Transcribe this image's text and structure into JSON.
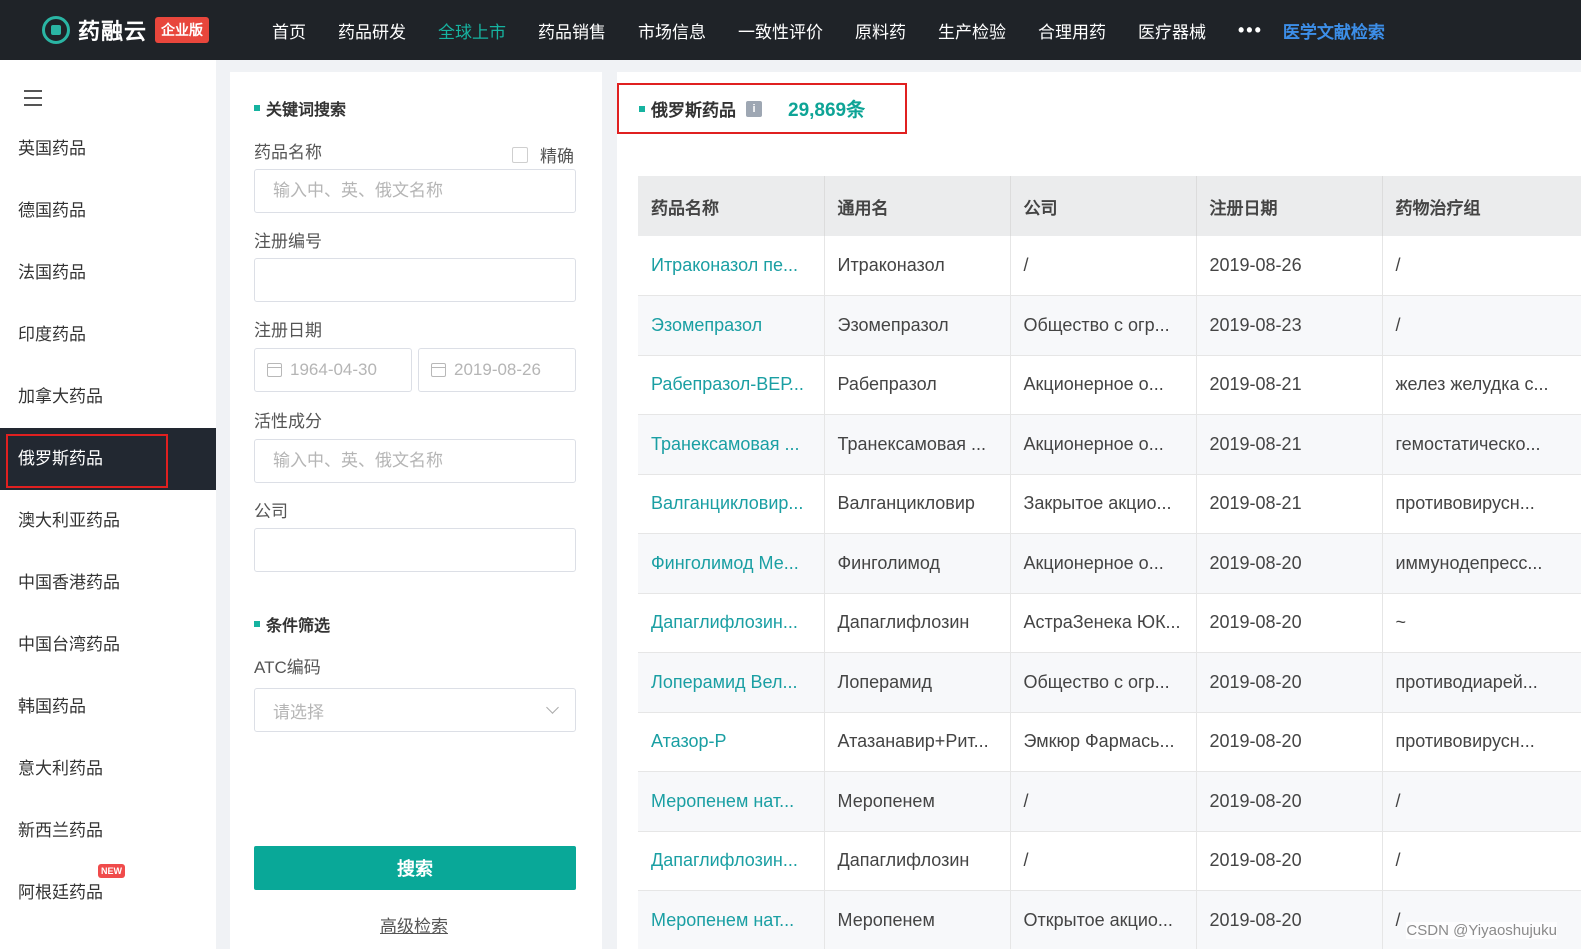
{
  "logo": {
    "name": "药融云",
    "badge": "企业版"
  },
  "nav": {
    "items": [
      "首页",
      "药品研发",
      "全球上市",
      "药品销售",
      "市场信息",
      "一致性评价",
      "原料药",
      "生产检验",
      "合理用药",
      "医疗器械"
    ],
    "active": "全球上市",
    "more": "•••",
    "literature": "医学文献检索"
  },
  "sidebar": {
    "items": [
      {
        "label": "英国药品"
      },
      {
        "label": "德国药品"
      },
      {
        "label": "法国药品"
      },
      {
        "label": "印度药品"
      },
      {
        "label": "加拿大药品"
      },
      {
        "label": "俄罗斯药品",
        "active": true
      },
      {
        "label": "澳大利亚药品"
      },
      {
        "label": "中国香港药品"
      },
      {
        "label": "中国台湾药品"
      },
      {
        "label": "韩国药品"
      },
      {
        "label": "意大利药品"
      },
      {
        "label": "新西兰药品"
      },
      {
        "label": "阿根廷药品",
        "badge": "NEW"
      }
    ]
  },
  "filter": {
    "keyword_title": "关键词搜索",
    "drug_name_label": "药品名称",
    "exact_label": "精确",
    "drug_name_placeholder": "输入中、英、俄文名称",
    "reg_no_label": "注册编号",
    "reg_date_label": "注册日期",
    "date_start": "1964-04-30",
    "date_end": "2019-08-26",
    "ingredient_label": "活性成分",
    "ingredient_placeholder": "输入中、英、俄文名称",
    "company_label": "公司",
    "condition_title": "条件筛选",
    "atc_label": "ATC编码",
    "atc_placeholder": "请选择",
    "search_button": "搜索",
    "advanced_link": "高级检索"
  },
  "results": {
    "title": "俄罗斯药品",
    "count": "29,869条",
    "columns": [
      "药品名称",
      "通用名",
      "公司",
      "注册日期",
      "药物治疗组"
    ],
    "rows": [
      [
        "Итраконазол пе...",
        "Итраконазол",
        "/",
        "2019-08-26",
        "/"
      ],
      [
        "Эзомепразол",
        "Эзомепразол",
        "Общество с огр...",
        "2019-08-23",
        "/"
      ],
      [
        "Рабепразол-ВЕР...",
        "Рабепразол",
        "Акционерное о...",
        "2019-08-21",
        "желез желудка с..."
      ],
      [
        "Транексамовая ...",
        "Транексамовая ...",
        "Акционерное о...",
        "2019-08-21",
        "гемостатическо..."
      ],
      [
        "Валганцикловир...",
        "Валганцикловир",
        "Закрытое акцио...",
        "2019-08-21",
        "противовирусн..."
      ],
      [
        "Финголимод Ме...",
        "Финголимод",
        "Акционерное о...",
        "2019-08-20",
        "иммунодепресс..."
      ],
      [
        "Дапаглифлозин...",
        "Дапаглифлозин",
        "АстраЗенека ЮК...",
        "2019-08-20",
        "~"
      ],
      [
        "Лоперамид Вел...",
        "Лоперамид",
        "Общество с огр...",
        "2019-08-20",
        "противодиарей..."
      ],
      [
        "Атазор-Р",
        "Атазанавир+Рит...",
        "Эмкюр Фармась...",
        "2019-08-20",
        "противовирусн..."
      ],
      [
        "Меропенем нат...",
        "Меропенем",
        "/",
        "2019-08-20",
        "/"
      ],
      [
        "Дапаглифлозин...",
        "Дапаглифлозин",
        "/",
        "2019-08-20",
        "/"
      ],
      [
        "Меропенем нат...",
        "Меропенем",
        "Открытое акцио...",
        "2019-08-20",
        "/"
      ]
    ]
  },
  "watermark": "CSDN @Yiyaoshujuku",
  "colors": {
    "accent": "#09a898",
    "topbar": "#1f2328",
    "highlight": "#e02020",
    "link": "#1a9fa3"
  }
}
